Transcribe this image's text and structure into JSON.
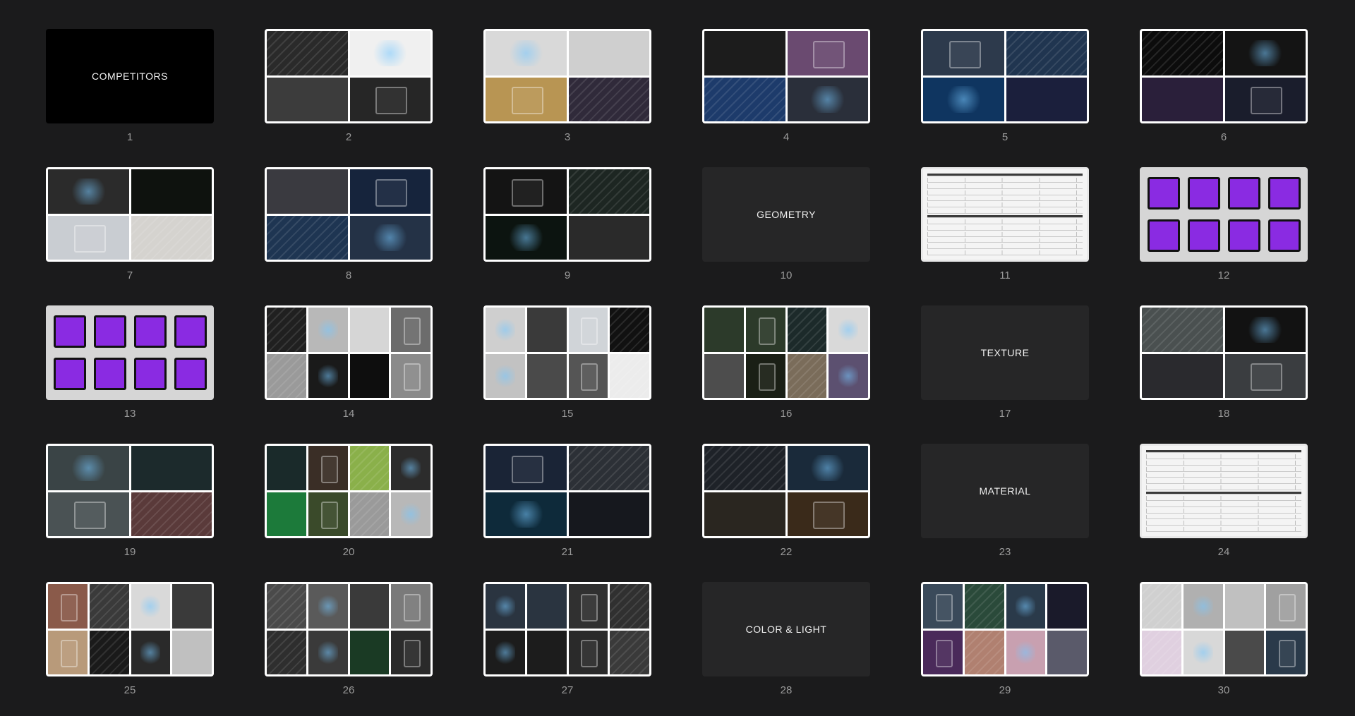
{
  "slides": [
    {
      "number": "1",
      "kind": "title-black",
      "title": "COMPETITORS"
    },
    {
      "number": "2",
      "kind": "collage",
      "layout": "g2",
      "tiles": [
        "#2a2a2a",
        "#f0f0f0",
        "#3c3c3c",
        "#262626"
      ]
    },
    {
      "number": "3",
      "kind": "collage",
      "layout": "g2",
      "tiles": [
        "#d9d9d9",
        "#cfcfcf",
        "#b89553",
        "#302a3a"
      ]
    },
    {
      "number": "4",
      "kind": "collage",
      "layout": "g2",
      "tiles": [
        "#1c1c1c",
        "#6a4a70",
        "#1d3b6b",
        "#2a2f3a"
      ]
    },
    {
      "number": "5",
      "kind": "collage",
      "layout": "g2",
      "tiles": [
        "#2d3a4c",
        "#203550",
        "#0f3560",
        "#1b1f3c"
      ]
    },
    {
      "number": "6",
      "kind": "collage",
      "layout": "g2",
      "tiles": [
        "#0c0c0c",
        "#141414",
        "#2a1f3a",
        "#1a1d2c"
      ]
    },
    {
      "number": "7",
      "kind": "collage",
      "layout": "g2",
      "tiles": [
        "#2b2b2b",
        "#0e120e",
        "#c9cdd2",
        "#d5d3cf"
      ]
    },
    {
      "number": "8",
      "kind": "collage",
      "layout": "g2",
      "tiles": [
        "#3a3a40",
        "#16243c",
        "#1e3552",
        "#243246"
      ]
    },
    {
      "number": "9",
      "kind": "collage",
      "layout": "g2",
      "tiles": [
        "#141414",
        "#1d2622",
        "#0c1410",
        "#2a2a2a"
      ]
    },
    {
      "number": "10",
      "kind": "title-dark",
      "title": "GEOMETRY"
    },
    {
      "number": "11",
      "kind": "table"
    },
    {
      "number": "12",
      "kind": "grey"
    },
    {
      "number": "13",
      "kind": "grey"
    },
    {
      "number": "14",
      "kind": "collage",
      "layout": "g4",
      "tiles": [
        "#202020",
        "#b8b8b8",
        "#d6d6d6",
        "#6c6c6c",
        "#9a9a9a",
        "#1a1a1a",
        "#0e0e0e",
        "#8a8a8a"
      ]
    },
    {
      "number": "15",
      "kind": "collage",
      "layout": "g4",
      "tiles": [
        "#cfcfcf",
        "#3a3a3a",
        "#d0d4d8",
        "#111111",
        "#c2c2c2",
        "#4a4a4a",
        "#555555",
        "#ececec"
      ]
    },
    {
      "number": "16",
      "kind": "collage",
      "layout": "g4",
      "tiles": [
        "#2c3a2a",
        "#2c3a2a",
        "#1c2a2a",
        "#d9d9d9",
        "#4d4d4d",
        "#1a1f15",
        "#7a6c5a",
        "#5c5070"
      ]
    },
    {
      "number": "17",
      "kind": "title-dark",
      "title": "TEXTURE"
    },
    {
      "number": "18",
      "kind": "collage",
      "layout": "g2",
      "tiles": [
        "#4a5050",
        "#121212",
        "#2a2a2e",
        "#3a3d40"
      ]
    },
    {
      "number": "19",
      "kind": "collage",
      "layout": "g2",
      "tiles": [
        "#3a4446",
        "#1c2a2c",
        "#4a5254",
        "#5a3a3a"
      ]
    },
    {
      "number": "20",
      "kind": "collage",
      "layout": "g4",
      "tiles": [
        "#1a2a2a",
        "#3a2e26",
        "#8ab04a",
        "#2c2c2c",
        "#1c7a3a",
        "#3a4a2a",
        "#9a9a9a",
        "#b8b8b8"
      ]
    },
    {
      "number": "21",
      "kind": "collage",
      "layout": "g2",
      "tiles": [
        "#1a2436",
        "#2c3036",
        "#0e2a3a",
        "#16181e"
      ]
    },
    {
      "number": "22",
      "kind": "collage",
      "layout": "g2",
      "tiles": [
        "#1e2228",
        "#1a2a3a",
        "#2a2620",
        "#3a2a1a"
      ]
    },
    {
      "number": "23",
      "kind": "title-dark",
      "title": "MATERIAL"
    },
    {
      "number": "24",
      "kind": "table"
    },
    {
      "number": "25",
      "kind": "collage",
      "layout": "g4",
      "tiles": [
        "#8a5a4a",
        "#3a3a3a",
        "#d9d9d9",
        "#3a3a3a",
        "#b89a7a",
        "#1a1a1a",
        "#2a2a2a",
        "#c0c0c0"
      ]
    },
    {
      "number": "26",
      "kind": "collage",
      "layout": "g4",
      "tiles": [
        "#4a4a4a",
        "#5a5a5a",
        "#3a3a3a",
        "#7a7a7a",
        "#2e2e2e",
        "#3a3a3a",
        "#1a3a24",
        "#2a2a2a"
      ]
    },
    {
      "number": "27",
      "kind": "collage",
      "layout": "g4",
      "tiles": [
        "#2a3440",
        "#2a3440",
        "#303030",
        "#303030",
        "#1c1c1c",
        "#1c1c1c",
        "#2a2a2a",
        "#3a3a3a"
      ]
    },
    {
      "number": "28",
      "kind": "title-dark",
      "title": "COLOR & LIGHT"
    },
    {
      "number": "29",
      "kind": "collage",
      "layout": "g4",
      "tiles": [
        "#3a4a5a",
        "#2a4a3a",
        "#2a3a4a",
        "#1a1a2a",
        "#4a2a5a",
        "#b08070",
        "#c8a0b0",
        "#5a5a6a"
      ]
    },
    {
      "number": "30",
      "kind": "collage",
      "layout": "g4",
      "tiles": [
        "#d0d0d0",
        "#b0b0b0",
        "#c0c0c0",
        "#a0a0a0",
        "#e0d0e0",
        "#d8d8d8",
        "#4a4a4a",
        "#2a3a4a"
      ]
    }
  ]
}
